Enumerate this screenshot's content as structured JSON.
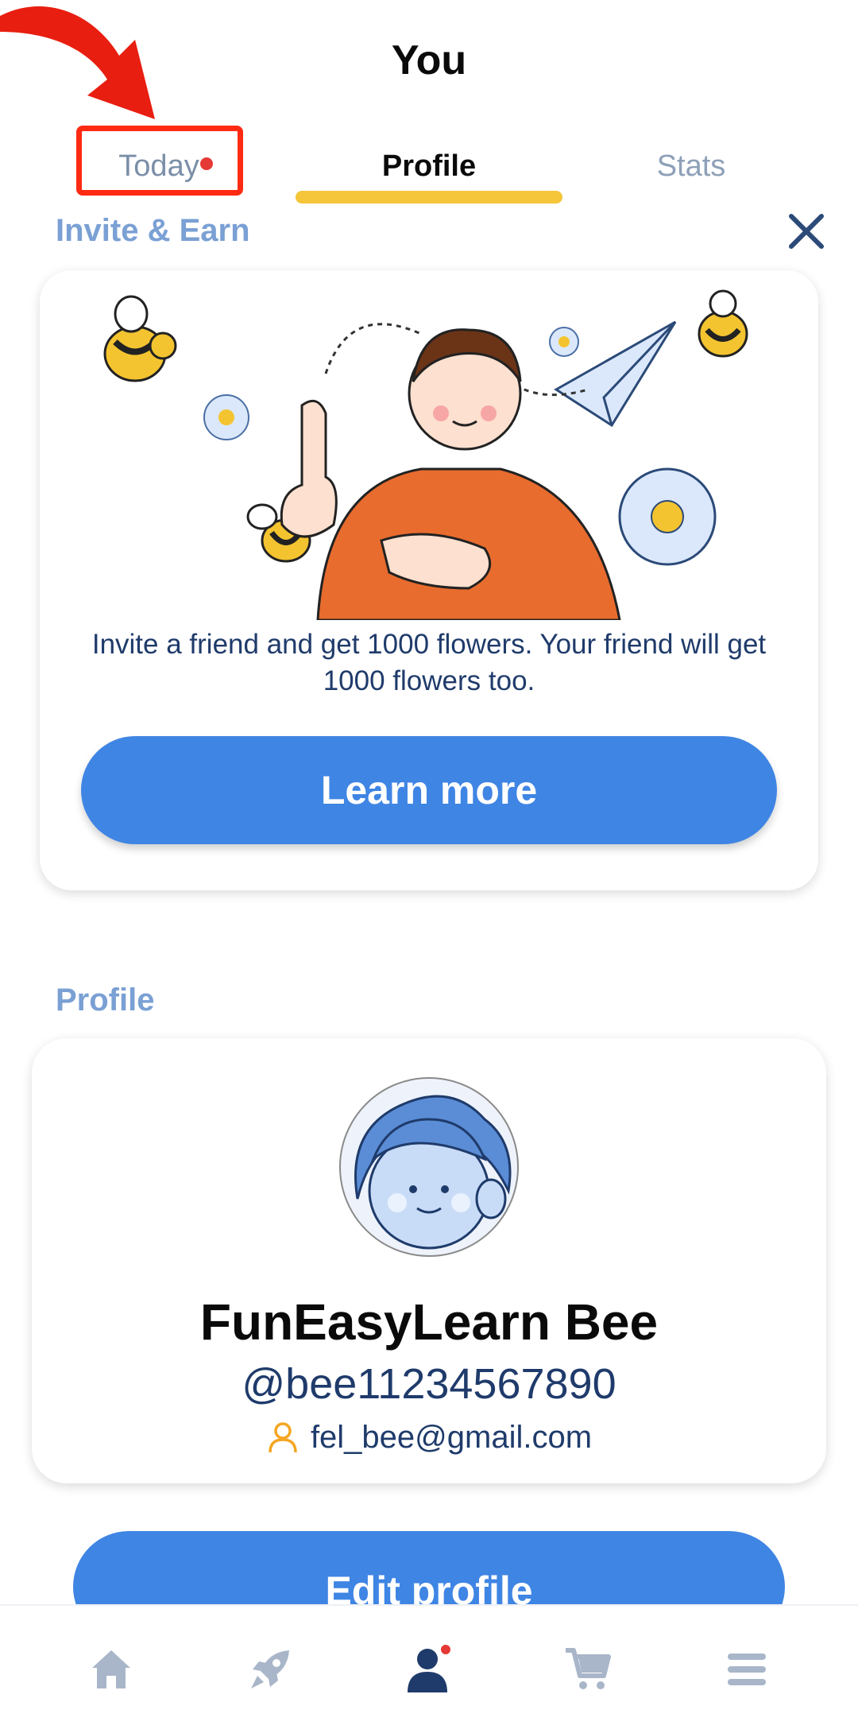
{
  "header": {
    "title": "You"
  },
  "tabs": [
    {
      "label": "Today",
      "has_notification": true
    },
    {
      "label": "Profile",
      "active": true
    },
    {
      "label": "Stats"
    }
  ],
  "invite": {
    "section_label": "Invite & Earn",
    "description": "Invite a friend and get 1000 flowers. Your friend will get 1000 flowers too.",
    "button_label": "Learn more"
  },
  "profile": {
    "section_label": "Profile",
    "display_name": "FunEasyLearn Bee",
    "username": "@bee11234567890",
    "email": "fel_bee@gmail.com",
    "edit_button_label": "Edit profile"
  },
  "nav": [
    {
      "icon": "home-icon"
    },
    {
      "icon": "rocket-icon"
    },
    {
      "icon": "profile-icon",
      "active": true,
      "has_notification": true
    },
    {
      "icon": "cart-icon"
    },
    {
      "icon": "menu-icon"
    }
  ],
  "colors": {
    "accent_blue": "#3f85e4",
    "tab_underline": "#f5c53a",
    "section_label": "#7aa0d4",
    "notification_dot": "#e53935",
    "annotation_red": "#ff2a12",
    "text_dark_blue": "#1f3b6b"
  }
}
